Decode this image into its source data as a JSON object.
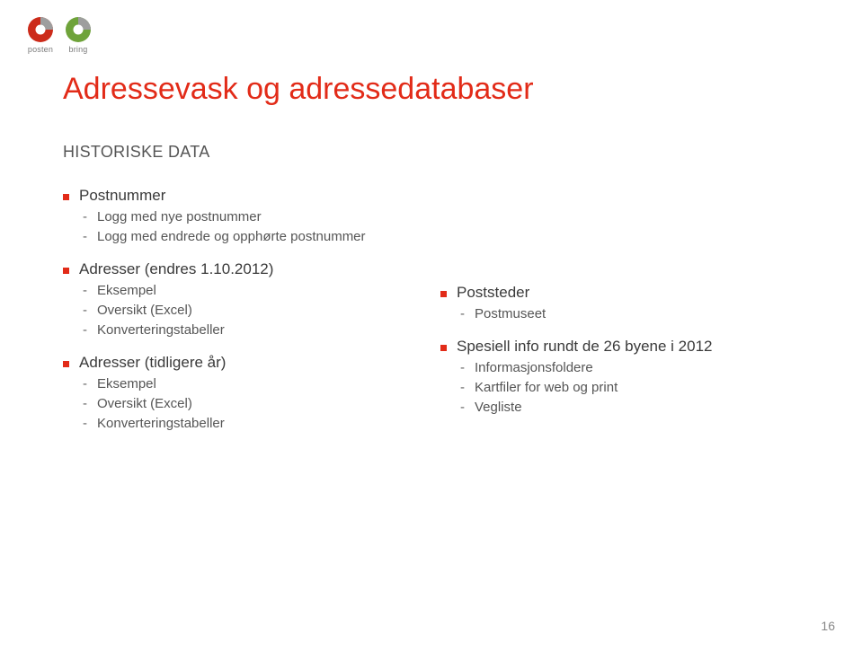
{
  "logos": {
    "posten_label": "posten",
    "bring_label": "bring"
  },
  "title": "Adressevask og adressedatabaser",
  "subtitle": "HISTORISKE DATA",
  "left": {
    "items": [
      {
        "label": "Postnummer",
        "sub": [
          "Logg med nye postnummer",
          "Logg med endrede og opphørte postnummer"
        ]
      },
      {
        "label": "Adresser (endres 1.10.2012)",
        "sub": [
          "Eksempel",
          "Oversikt (Excel)",
          "Konverteringstabeller"
        ]
      },
      {
        "label": "Adresser (tidligere år)",
        "sub": [
          "Eksempel",
          "Oversikt (Excel)",
          "Konverteringstabeller"
        ]
      }
    ]
  },
  "right": {
    "items": [
      {
        "label": "Poststeder",
        "sub": [
          "Postmuseet"
        ]
      },
      {
        "label": "Spesiell info rundt de 26 byene i 2012",
        "sub": [
          "Informasjonsfoldere",
          "Kartfiler for web og print",
          "Vegliste"
        ]
      }
    ]
  },
  "page_number": "16"
}
